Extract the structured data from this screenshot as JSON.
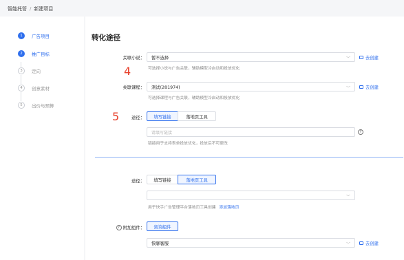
{
  "breadcrumb": {
    "root": "智能托管",
    "separator": "/",
    "current": "新建项目"
  },
  "steps": [
    {
      "num": "1",
      "label": "广告项目",
      "state": "active"
    },
    {
      "num": "2",
      "label": "推广目标",
      "state": "active"
    },
    {
      "num": "3",
      "label": "定向",
      "state": "inactive"
    },
    {
      "num": "4",
      "label": "创意素材",
      "state": "inactive"
    },
    {
      "num": "5",
      "label": "出价与预算",
      "state": "inactive"
    }
  ],
  "section_title": "转化途径",
  "novel": {
    "label": "关联小说：",
    "value": "暂不选择",
    "create": "去创建",
    "hint": "可选择小说与广告关联，辅助模型冷启动和投放优化"
  },
  "course": {
    "label": "关联课程：",
    "value": "测试(281974)",
    "create": "去创建",
    "hint": "可选择课程与广告关联，辅助模型冷启动和投放优化"
  },
  "annotations": {
    "four": "4",
    "five": "5"
  },
  "path1": {
    "label": "途径：",
    "opt_link": "填写链接",
    "opt_tool": "落地页工具",
    "selected": "link",
    "placeholder": "请填写链接",
    "hint": "链接用于支持表单投放优化，投放后不可更改"
  },
  "path2": {
    "label": "途径：",
    "opt_link": "填写链接",
    "opt_tool": "落地页工具",
    "selected": "tool",
    "value": "",
    "hint": "用于快手广告管理平台落地页工具创建",
    "hint_link": "添加落地页"
  },
  "addon": {
    "label": "附加组件：",
    "button": "咨询组件",
    "value": "快聊客服",
    "create": "去创建"
  },
  "colors": {
    "accent": "#2f6fed",
    "annotation": "#e8412c"
  }
}
